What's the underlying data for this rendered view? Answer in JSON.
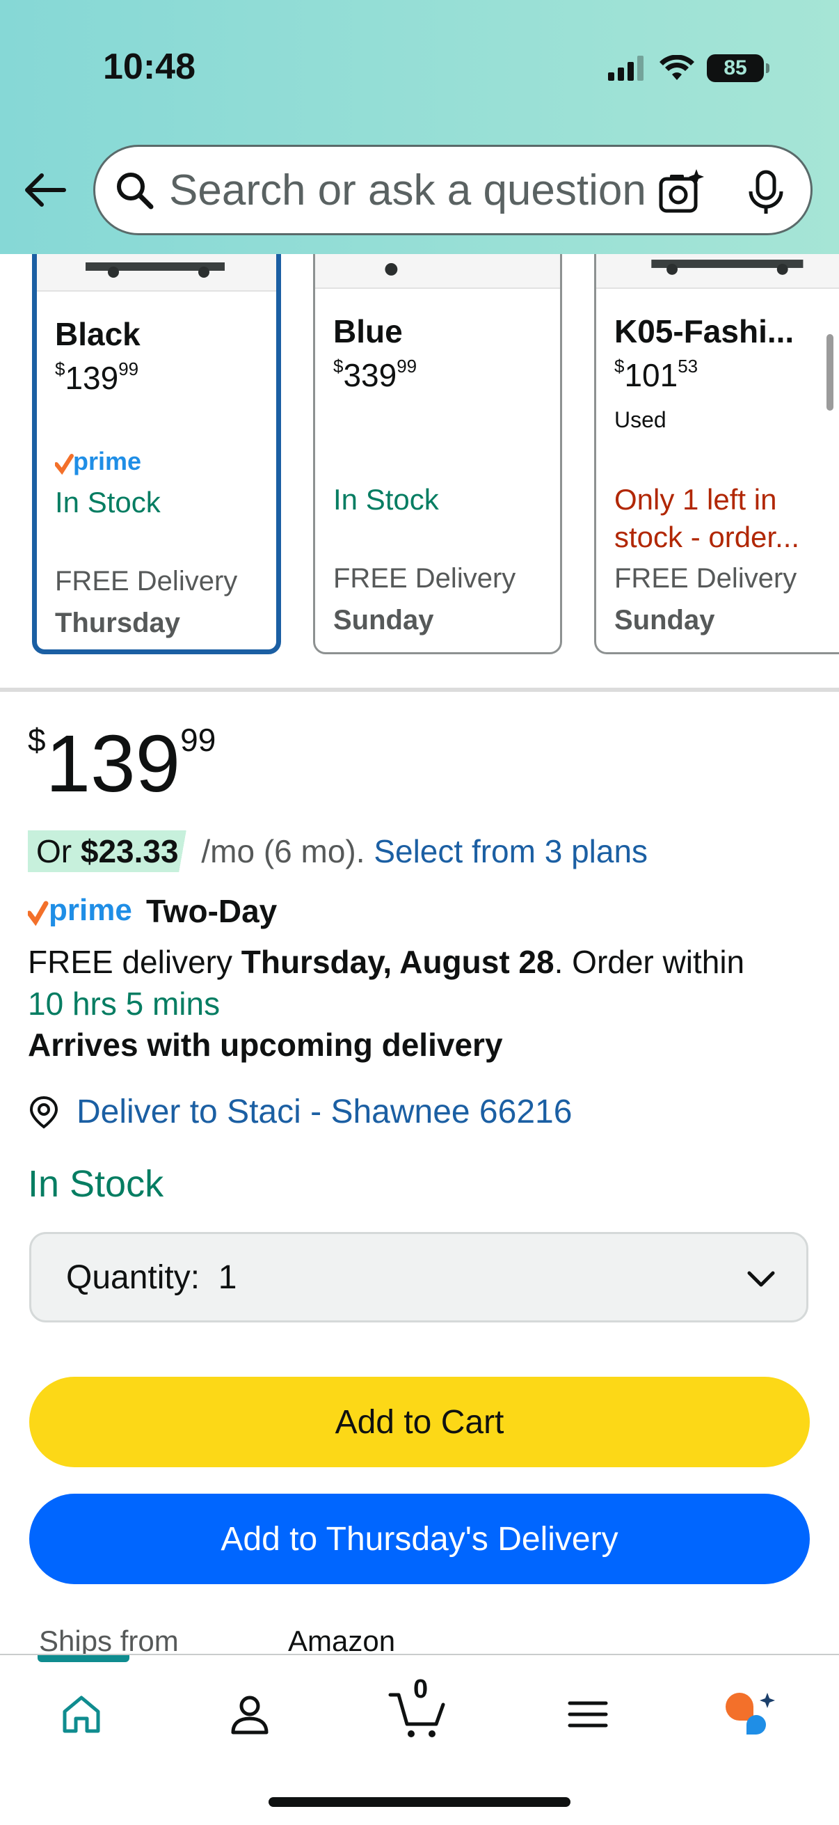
{
  "status_bar": {
    "time": "10:48",
    "battery": "85"
  },
  "search": {
    "placeholder": "Search or ask a question"
  },
  "variants": [
    {
      "name": "Black",
      "price_dollars": "139",
      "price_cents": "99",
      "condition": "",
      "prime": true,
      "stock": "In Stock",
      "delivery": "FREE Delivery",
      "day": "Thursday",
      "selected": true
    },
    {
      "name": "Blue",
      "price_dollars": "339",
      "price_cents": "99",
      "condition": "",
      "prime": false,
      "stock": "In Stock",
      "delivery": "FREE Delivery",
      "day": "Sunday",
      "selected": false
    },
    {
      "name": "K05-Fashi...",
      "price_dollars": "101",
      "price_cents": "53",
      "condition": "Used",
      "prime": false,
      "stock": "Only 1 left in stock - order...",
      "delivery": "FREE Delivery",
      "day": "Sunday",
      "selected": false
    }
  ],
  "price": {
    "currency": "$",
    "dollars": "139",
    "cents": "99"
  },
  "installment": {
    "prefix": "Or ",
    "amount": "$23.33",
    "term": " /mo (6 mo). ",
    "plans_link": "Select from 3 plans"
  },
  "prime": {
    "wordmark": "prime",
    "speed": "Two-Day"
  },
  "delivery": {
    "prefix": "FREE delivery ",
    "date": "Thursday, August 28",
    "suffix": ". Order within",
    "countdown": "10 hrs 5 mins",
    "arrives": "Arrives with upcoming delivery"
  },
  "deliver_to": "Deliver to Staci - Shawnee 66216",
  "availability": "In Stock",
  "quantity": {
    "label": "Quantity:",
    "value": "1"
  },
  "buttons": {
    "add_to_cart": "Add to Cart",
    "add_to_delivery": "Add to Thursday's Delivery"
  },
  "ships_from": {
    "label": "Ships from",
    "value": "Amazon"
  },
  "nav": {
    "cart_count": "0"
  },
  "colors": {
    "header_start": "#86d8d6",
    "header_end": "#a6e5d6",
    "stock_green": "#067d62",
    "link_blue": "#1b5fa3",
    "cart_yellow": "#fcd817",
    "delivery_blue": "#0066ff",
    "prime_orange": "#f3702a",
    "prime_blue": "#1f8ee6",
    "low_stock_red": "#b12704"
  }
}
